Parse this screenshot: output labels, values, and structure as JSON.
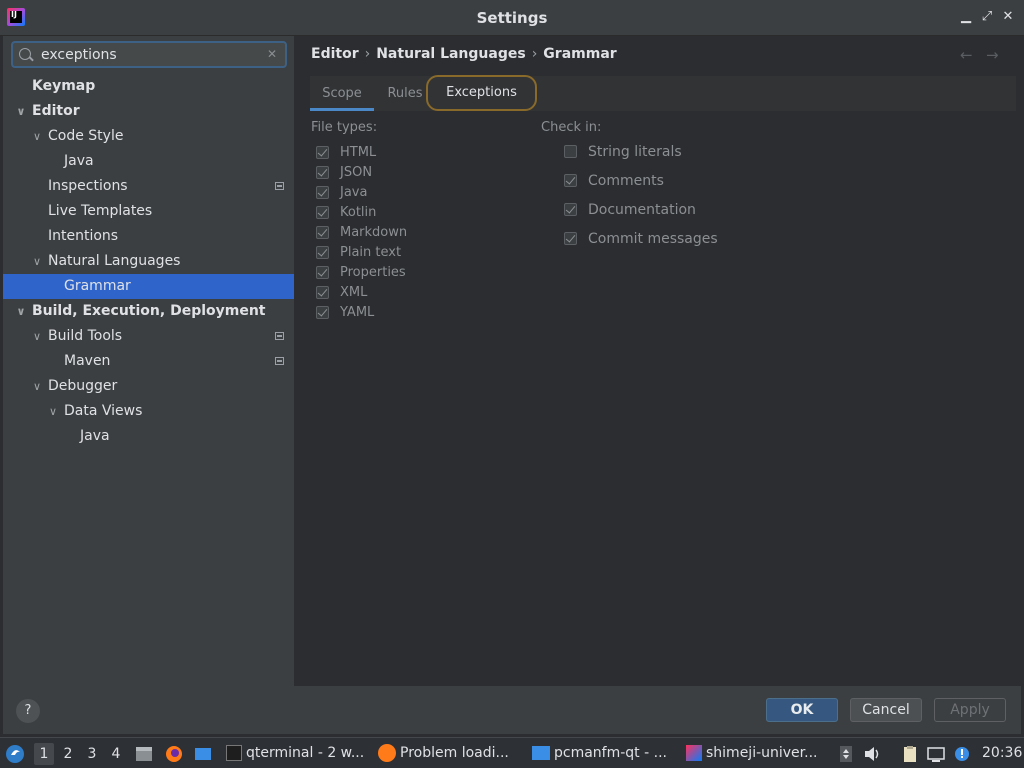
{
  "window": {
    "title": "Settings",
    "app_icon_text": "IJ"
  },
  "search": {
    "value": "exceptions",
    "placeholder": ""
  },
  "tree": [
    {
      "label": "Keymap",
      "bold": true,
      "level": 0,
      "chevron": false,
      "project": false,
      "selected": false
    },
    {
      "label": "Editor",
      "bold": true,
      "level": 0,
      "chevron": true,
      "project": false,
      "selected": false
    },
    {
      "label": "Code Style",
      "bold": false,
      "level": 1,
      "chevron": true,
      "project": false,
      "selected": false
    },
    {
      "label": "Java",
      "bold": false,
      "level": 2,
      "chevron": false,
      "project": false,
      "selected": false
    },
    {
      "label": "Inspections",
      "bold": false,
      "level": 1,
      "chevron": false,
      "project": true,
      "selected": false
    },
    {
      "label": "Live Templates",
      "bold": false,
      "level": 1,
      "chevron": false,
      "project": false,
      "selected": false
    },
    {
      "label": "Intentions",
      "bold": false,
      "level": 1,
      "chevron": false,
      "project": false,
      "selected": false
    },
    {
      "label": "Natural Languages",
      "bold": false,
      "level": 1,
      "chevron": true,
      "project": false,
      "selected": false
    },
    {
      "label": "Grammar",
      "bold": false,
      "level": 2,
      "chevron": false,
      "project": false,
      "selected": true
    },
    {
      "label": "Build, Execution, Deployment",
      "bold": true,
      "level": 0,
      "chevron": true,
      "project": false,
      "selected": false
    },
    {
      "label": "Build Tools",
      "bold": false,
      "level": 1,
      "chevron": true,
      "project": true,
      "selected": false
    },
    {
      "label": "Maven",
      "bold": false,
      "level": 2,
      "chevron": false,
      "project": true,
      "selected": false
    },
    {
      "label": "Debugger",
      "bold": false,
      "level": 1,
      "chevron": true,
      "project": false,
      "selected": false
    },
    {
      "label": "Data Views",
      "bold": false,
      "level": 2,
      "chevron": true,
      "project": false,
      "selected": false
    },
    {
      "label": "Java",
      "bold": false,
      "level": 3,
      "chevron": false,
      "project": false,
      "selected": false
    }
  ],
  "breadcrumb": {
    "part1": "Editor",
    "part2": "Natural Languages",
    "part3": "Grammar",
    "sep": "›"
  },
  "nav": {
    "back": "←",
    "forward": "→"
  },
  "tabs": {
    "scope": "Scope",
    "rules": "Rules",
    "exceptions": "Exceptions"
  },
  "file_types": {
    "label": "File types:",
    "items": [
      {
        "label": "HTML",
        "checked": true
      },
      {
        "label": "JSON",
        "checked": true
      },
      {
        "label": "Java",
        "checked": true
      },
      {
        "label": "Kotlin",
        "checked": true
      },
      {
        "label": "Markdown",
        "checked": true
      },
      {
        "label": "Plain text",
        "checked": true
      },
      {
        "label": "Properties",
        "checked": true
      },
      {
        "label": "XML",
        "checked": true
      },
      {
        "label": "YAML",
        "checked": true
      }
    ]
  },
  "check_in": {
    "label": "Check in:",
    "items": [
      {
        "label": "String literals",
        "checked": false
      },
      {
        "label": "Comments",
        "checked": true
      },
      {
        "label": "Documentation",
        "checked": true
      },
      {
        "label": "Commit messages",
        "checked": true
      }
    ]
  },
  "buttons": {
    "help": "?",
    "ok": "OK",
    "cancel": "Cancel",
    "apply": "Apply"
  },
  "taskbar": {
    "workspaces": [
      "1",
      "2",
      "3",
      "4"
    ],
    "active_workspace": "1",
    "windows": [
      {
        "label": "qterminal - 2 w..."
      },
      {
        "label": "Problem loadi..."
      },
      {
        "label": "pcmanfm-qt - ..."
      },
      {
        "label": "shimeji-univer..."
      }
    ],
    "clock": "20:36"
  }
}
